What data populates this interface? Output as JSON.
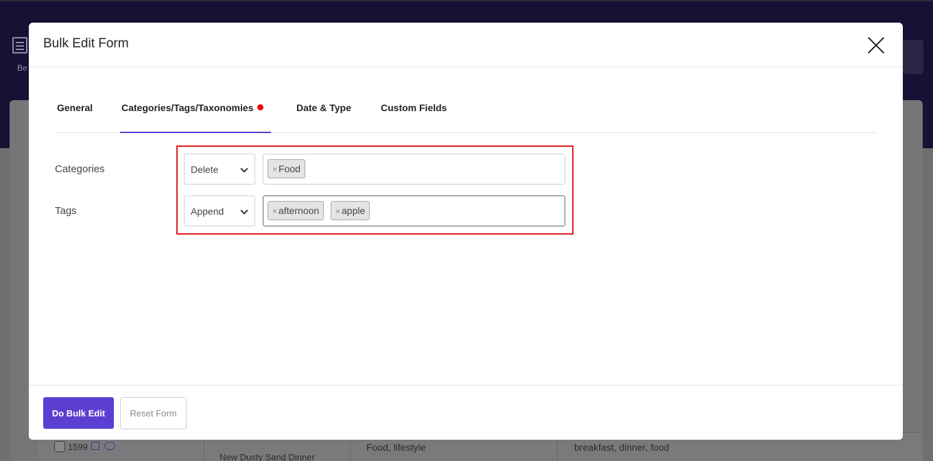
{
  "background": {
    "icon_label": "Be",
    "row": {
      "id": "1599",
      "title": "New Dusty Sand Dinner",
      "categories": "Food, lifestyle",
      "tags": "breakfast, dinner, food"
    }
  },
  "modal": {
    "title": "Bulk Edit Form",
    "tabs": [
      {
        "label": "General",
        "active": false
      },
      {
        "label": "Categories/Tags/Taxonomies",
        "active": true,
        "has_indicator": true
      },
      {
        "label": "Date & Type",
        "active": false
      },
      {
        "label": "Custom Fields",
        "active": false
      }
    ],
    "fields": {
      "categories": {
        "label": "Categories",
        "action": "Delete",
        "chips": [
          "Food"
        ]
      },
      "tags": {
        "label": "Tags",
        "action": "Append",
        "chips": [
          "afternoon",
          "apple"
        ]
      }
    },
    "footer": {
      "primary_label": "Do Bulk Edit",
      "secondary_label": "Reset Form"
    }
  },
  "colors": {
    "accent": "#5b3fd1",
    "indicator": "#ee0a0a",
    "highlight_border": "#e21b1b",
    "overlay_header": "#161235"
  },
  "icons": {
    "close": "close-icon",
    "select_arrow": "chevron-down-icon",
    "chip_remove": "remove-x-icon"
  }
}
